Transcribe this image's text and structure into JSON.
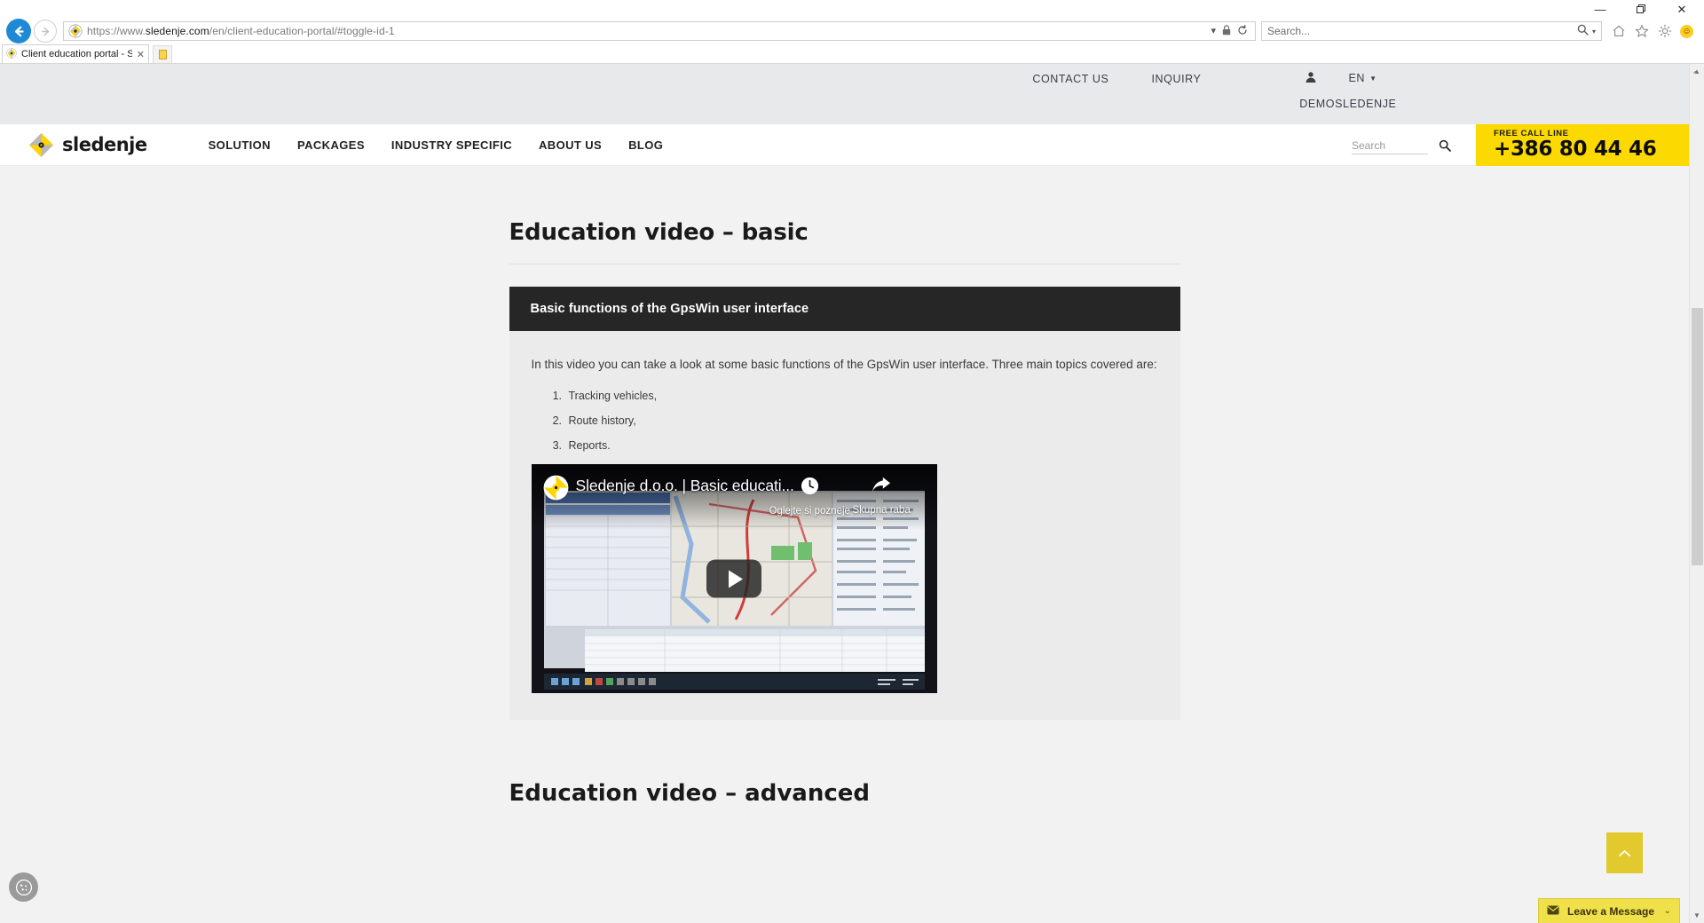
{
  "browser": {
    "name": "internet-explorer",
    "url_protocol": "https://www.",
    "url_domain": "sledenje.com",
    "url_path": "/en/client-education-portal/#toggle-id-1",
    "url_full": "https://www.sledenje.com/en/client-education-portal/#toggle-id-1",
    "search_placeholder": "Search...",
    "tab_title": "Client education portal - Sl...",
    "window_controls": {
      "minimize": "—",
      "maximize": "❐",
      "close": "✕"
    },
    "toolbar_icons": [
      "home-icon",
      "favorites-star-icon",
      "gear-icon",
      "smiley-icon"
    ],
    "address_icons": [
      "dropdown-caret-icon",
      "lock-icon",
      "refresh-icon"
    ]
  },
  "site": {
    "topbar": {
      "links": [
        {
          "label": "CONTACT US"
        },
        {
          "label": "INQUIRY"
        }
      ],
      "user_icon": "user-icon",
      "language": "EN",
      "language_caret": "▼",
      "demo_link": "DEMOSLEDENJE"
    },
    "header": {
      "logo_text": "sledenje",
      "nav": [
        {
          "label": "SOLUTION"
        },
        {
          "label": "PACKAGES"
        },
        {
          "label": "INDUSTRY SPECIFIC"
        },
        {
          "label": "ABOUT US"
        },
        {
          "label": "BLOG"
        }
      ],
      "search_placeholder": "Search",
      "search_value": "",
      "callbox": {
        "label": "FREE CALL LINE",
        "number": "+386 80 44 46",
        "color": "#fcd900"
      }
    },
    "main": {
      "heading": "Education video – basic",
      "card": {
        "title": "Basic functions of the GpsWin user interface",
        "intro": "In this video you can take a look at some basic functions of the GpsWin user interface. Three main topics covered are:",
        "list": [
          "Tracking vehicles,",
          "Route history,",
          "Reports."
        ],
        "video": {
          "title": "Sledenje d.o.o. | Basic educati...",
          "watch_later_label": "Oglejte si pozneje",
          "share_label": "Skupna raba",
          "play_icon": "play-icon",
          "clock_icon": "clock-icon",
          "share_icon": "share-arrow-icon",
          "channel_icon": "sledenje-channel-icon"
        }
      },
      "heading_next": "Education video – advanced"
    },
    "widgets": {
      "cookie_icon": "cookie-icon",
      "back_to_top_icon": "chevron-up-icon",
      "leave_message_label": "Leave a Message",
      "leave_message_icon": "envelope-icon",
      "leave_message_chevron": "⌄"
    }
  }
}
